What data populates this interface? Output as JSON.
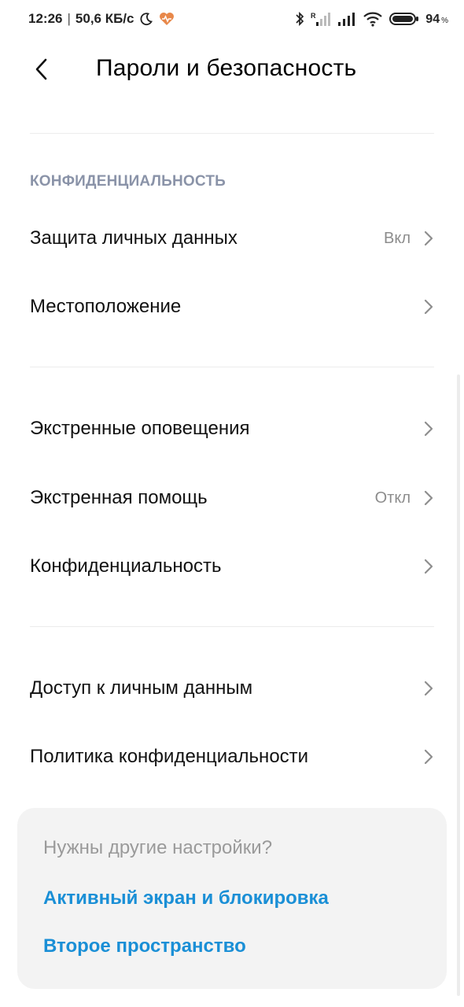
{
  "status_bar": {
    "time": "12:26",
    "speed": "50,6 КБ/с",
    "battery_level": "94",
    "battery_unit": "%",
    "icons": [
      "moon-icon",
      "health-icon",
      "bluetooth-icon",
      "signal-roaming-icon",
      "signal-icon",
      "wifi-icon",
      "battery-icon"
    ],
    "heart_color": "#e8884a"
  },
  "header": {
    "title": "Пароли и безопасность",
    "back_icon": "back-arrow-icon"
  },
  "privacy_section": {
    "header": "КОНФИДЕНЦИАЛЬНОСТЬ",
    "items": [
      {
        "label": "Защита личных данных",
        "value": "Вкл"
      },
      {
        "label": "Местоположение",
        "value": ""
      }
    ]
  },
  "emergency_section": {
    "items": [
      {
        "label": "Экстренные оповещения",
        "value": ""
      },
      {
        "label": "Экстренная помощь",
        "value": "Откл"
      },
      {
        "label": "Конфиденциальность",
        "value": ""
      }
    ]
  },
  "access_section": {
    "items": [
      {
        "label": "Доступ к личным данным",
        "value": ""
      },
      {
        "label": "Политика конфиденциальности",
        "value": ""
      }
    ]
  },
  "suggestion_card": {
    "title": "Нужны другие настройки?",
    "links": [
      "Активный экран и блокировка",
      "Второе пространство"
    ],
    "link_color": "#1a8fd6"
  }
}
